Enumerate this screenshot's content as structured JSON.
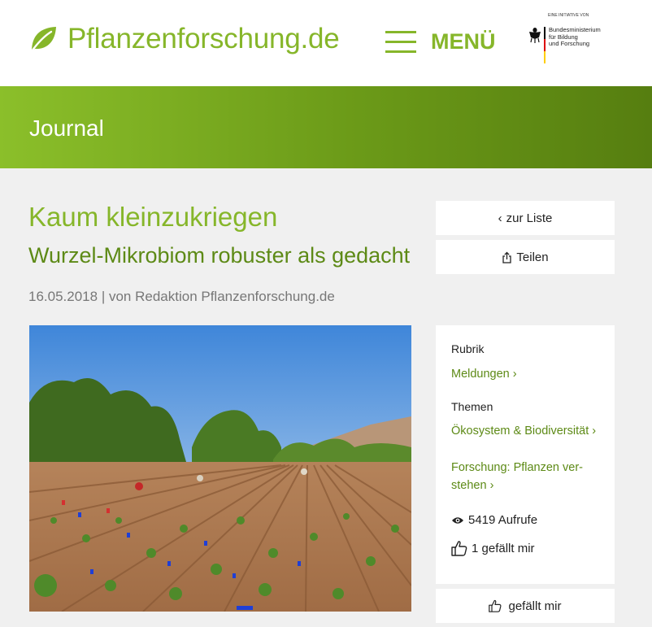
{
  "header": {
    "site_name": "Pflanzenforschung.de",
    "menu_label": "MENÜ",
    "sponsor_tag": "EINE INITIATIVE VON",
    "sponsor_line1": "Bundesministerium",
    "sponsor_line2": "für Bildung",
    "sponsor_line3": "und Forschung",
    "brand_color": "#86b62a"
  },
  "banner": {
    "title": "Journal"
  },
  "article": {
    "title": "Kaum kleinzukriegen",
    "subtitle": "Wurzel-Mikrobiom robuster als gedacht",
    "date": "16.05.2018",
    "separator": " | ",
    "author": "von Redaktion Pflanzenforschung.de"
  },
  "actions": {
    "back_label": "zur Liste",
    "back_icon": "‹",
    "share_label": "Teilen"
  },
  "sidebar": {
    "rubrik_label": "Rubrik",
    "rubrik_value": "Meldungen ›",
    "themen_label": "Themen",
    "themen_items": [
      "Ökosystem & Biodiversität ›",
      "Forschung: Pflanzen ver-stehen ›"
    ],
    "views": "5419 Aufrufe",
    "likes": "1 gefällt mir"
  },
  "like_button": {
    "label": "gefällt mir"
  }
}
